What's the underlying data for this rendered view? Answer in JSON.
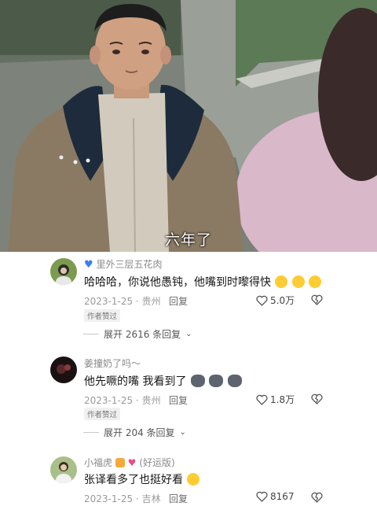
{
  "video": {
    "subtitle": "六年了"
  },
  "comments": [
    {
      "username": "里外三层五花肉",
      "username_icon": "blue-heart-icon",
      "text": "哈哈哈，你说他愚钝，他嘴到时嚟得快",
      "emoji": [
        "crying-laugh-emoji",
        "crying-laugh-emoji",
        "crying-laugh-emoji"
      ],
      "date": "2023-1-25",
      "location": "贵州",
      "reply_label": "回复",
      "likes": "5.0万",
      "badge": "作者赞过",
      "expand": "展开 2616 条回复"
    },
    {
      "username": "姜撞奶了吗～",
      "text": "他先噘的嘴  我看到了",
      "emoji": [
        "husky-emoji",
        "husky-emoji",
        "husky-emoji"
      ],
      "date": "2023-1-25",
      "location": "贵州",
      "reply_label": "回复",
      "likes": "1.8万",
      "badge": "作者赞过",
      "expand": "展开 204 条回复"
    },
    {
      "username": "小福虎",
      "username_suffix": "(好运版)",
      "username_icons": [
        "tiger-icon",
        "hearts-icon"
      ],
      "text": "张译看多了也挺好看",
      "emoji": [
        "laughing-emoji"
      ],
      "date": "2023-1-25",
      "location": "吉林",
      "reply_label": "回复",
      "likes": "8167"
    }
  ],
  "colors": {
    "text": "#161616",
    "meta": "#9a9a9a",
    "heart_blue": "#3b7df0",
    "emoji_yellow": "#ffcc33"
  }
}
